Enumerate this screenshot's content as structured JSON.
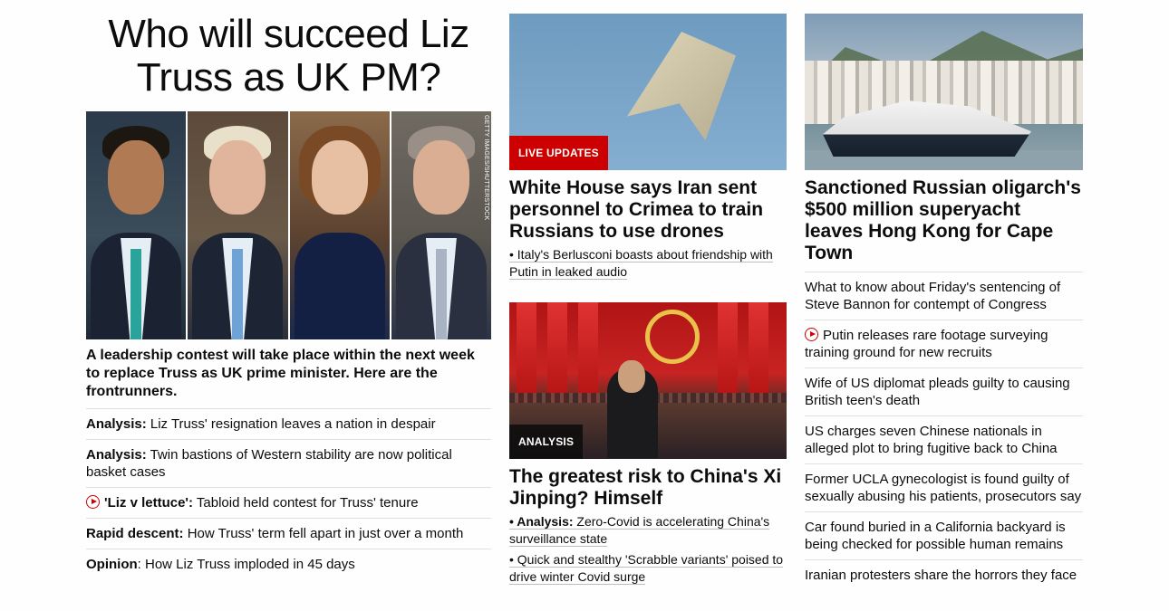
{
  "col1": {
    "headline": "Who will succeed Liz Truss as UK PM?",
    "image_credit": "GETTY IMAGES/SHUTTERSTOCK",
    "description": "A leadership contest will take place within the next week to replace Truss as UK prime minister. Here are the frontrunners.",
    "links": [
      {
        "prefix": "Analysis:",
        "text": " Liz Truss' resignation leaves a nation in despair"
      },
      {
        "prefix": "Analysis:",
        "text": " Twin bastions of Western stability are now political basket cases"
      },
      {
        "prefix": "'Liz v lettuce':",
        "text": " Tabloid held contest for Truss' tenure",
        "icon": "play-icon"
      },
      {
        "prefix": "Rapid descent:",
        "text": " How Truss' term fell apart in just over a month"
      },
      {
        "prefix": "Opinion",
        "text": ": How Liz Truss imploded in 45 days"
      }
    ]
  },
  "col2": {
    "story1": {
      "badge": "LIVE UPDATES",
      "title": "White House says Iran sent personnel to Crimea to train Russians to use drones",
      "sublink": "• Italy's Berlusconi boasts about friendship with Putin in leaked audio"
    },
    "story2": {
      "badge": "ANALYSIS",
      "title": "The greatest risk to China's Xi Jinping? Himself",
      "sublink1_prefix": "• Analysis:",
      "sublink1_text": " Zero-Covid is accelerating China's surveillance state",
      "sublink2": "• Quick and stealthy 'Scrabble variants' poised to drive winter Covid surge"
    }
  },
  "col3": {
    "title": "Sanctioned Russian oligarch's $500 million superyacht leaves Hong Kong for Cape Town",
    "items": [
      {
        "text": "What to know about Friday's sentencing of Steve Bannon for contempt of Congress"
      },
      {
        "text": "Putin releases rare footage surveying training ground for new recruits",
        "icon": "play-icon"
      },
      {
        "text": "Wife of US diplomat pleads guilty to causing British teen's death"
      },
      {
        "text": "US charges seven Chinese nationals in alleged plot to bring fugitive back to China"
      },
      {
        "text": "Former UCLA gynecologist is found guilty of sexually abusing his patients, prosecutors say"
      },
      {
        "text": "Car found buried in a California backyard is being checked for possible human remains"
      },
      {
        "text": "Iranian protesters share the horrors they face"
      }
    ]
  },
  "colors": {
    "accent": "#cc0000",
    "text": "#0c0c0c",
    "divider": "#e0e0e0"
  }
}
